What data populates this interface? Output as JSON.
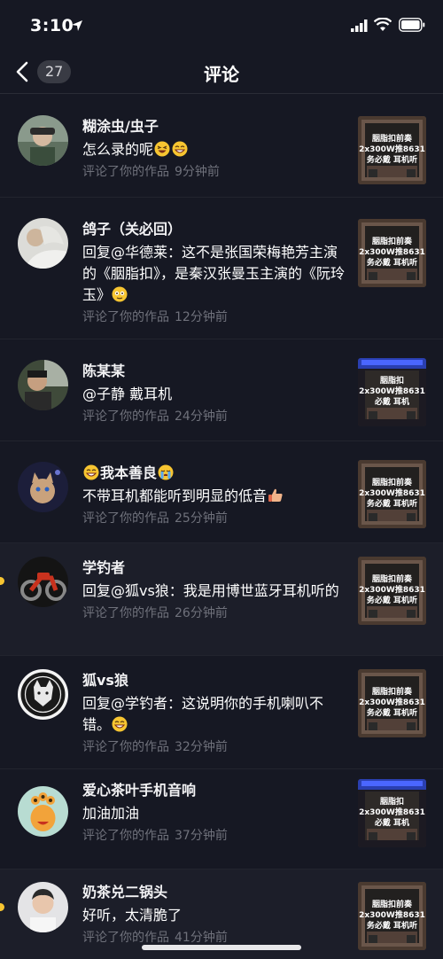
{
  "status": {
    "time": "3:10"
  },
  "nav": {
    "back_count": "27",
    "title": "评论"
  },
  "meta_prefix": "评论了你的作品",
  "comments": [
    {
      "name": "糊涂虫/虫子",
      "text": "怎么录的呢",
      "time": "9分钟前",
      "thumb_caption": [
        "胭脂扣前奏",
        "2x300W推8631",
        "务必戴  耳机听"
      ]
    },
    {
      "name": "鸽子（关必回）",
      "text": "回复@华德莱：这不是张国荣梅艳芳主演的《胭脂扣》，是秦汉张曼玉主演的《阮玲玉》",
      "time": "12分钟前",
      "thumb_caption": [
        "胭脂扣前奏",
        "2x300W推8631",
        "务必戴  耳机听"
      ]
    },
    {
      "name": "陈某某",
      "text": "@子静 戴耳机",
      "time": "24分钟前",
      "thumb_caption": [
        "胭脂扣",
        "2x300W推8631",
        "必戴  耳机"
      ]
    },
    {
      "name": "我本善良",
      "text": "不带耳机都能听到明显的低音",
      "time": "25分钟前",
      "thumb_caption": [
        "胭脂扣前奏",
        "2x300W推8631",
        "务必戴  耳机听"
      ]
    },
    {
      "name": "学钓者",
      "text": "回复@狐vs狼：我是用博世蓝牙耳机听的",
      "time": "26分钟前",
      "thumb_caption": [
        "胭脂扣前奏",
        "2x300W推8631",
        "务必戴  耳机听"
      ]
    },
    {
      "name": "狐vs狼",
      "text": "回复@学钓者：这说明你的手机喇叭不错。",
      "time": "32分钟前",
      "thumb_caption": [
        "胭脂扣前奏",
        "2x300W推8631",
        "务必戴  耳机听"
      ]
    },
    {
      "name": "爱心茶叶手机音响",
      "text": "加油加油",
      "time": "37分钟前",
      "thumb_caption": [
        "胭脂扣",
        "2x300W推8631",
        "必戴  耳机"
      ]
    },
    {
      "name": "奶茶兑二锅头",
      "text": "好听，太清脆了",
      "time": "41分钟前",
      "thumb_caption": [
        "胭脂扣前奏",
        "2x300W推8631",
        "务必戴  耳机听"
      ]
    }
  ]
}
